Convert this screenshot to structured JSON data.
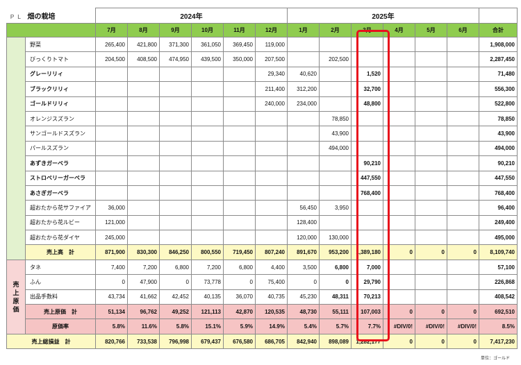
{
  "header": {
    "prefix": "ＰＬ",
    "title": "畑の栽培",
    "year1": "2024年",
    "year2": "2025年"
  },
  "months": [
    "7月",
    "8月",
    "9月",
    "10月",
    "11月",
    "12月",
    "1月",
    "2月",
    "3月",
    "4月",
    "5月",
    "6月"
  ],
  "total_label": "合計",
  "items": [
    {
      "name": "野菜",
      "bold": false,
      "values": [
        "265,400",
        "421,800",
        "371,300",
        "361,050",
        "369,450",
        "119,000",
        "",
        "",
        "",
        "",
        "",
        ""
      ],
      "total": "1,908,000"
    },
    {
      "name": "びっくりトマト",
      "bold": false,
      "values": [
        "204,500",
        "408,500",
        "474,950",
        "439,500",
        "350,000",
        "207,500",
        "",
        "202,500",
        "",
        "",
        "",
        ""
      ],
      "total": "2,287,450"
    },
    {
      "name": "グレーリリィ",
      "bold": true,
      "values": [
        "",
        "",
        "",
        "",
        "",
        "29,340",
        "40,620",
        "",
        "1,520",
        "",
        "",
        ""
      ],
      "total": "71,480"
    },
    {
      "name": "ブラックリリィ",
      "bold": true,
      "values": [
        "",
        "",
        "",
        "",
        "",
        "211,400",
        "312,200",
        "",
        "32,700",
        "",
        "",
        ""
      ],
      "total": "556,300"
    },
    {
      "name": "ゴールドリリィ",
      "bold": true,
      "values": [
        "",
        "",
        "",
        "",
        "",
        "240,000",
        "234,000",
        "",
        "48,800",
        "",
        "",
        ""
      ],
      "total": "522,800"
    },
    {
      "name": "オレンジスズラン",
      "bold": false,
      "values": [
        "",
        "",
        "",
        "",
        "",
        "",
        "",
        "78,850",
        "",
        "",
        "",
        ""
      ],
      "total": "78,850"
    },
    {
      "name": "サンゴールドスズラン",
      "bold": false,
      "values": [
        "",
        "",
        "",
        "",
        "",
        "",
        "",
        "43,900",
        "",
        "",
        "",
        ""
      ],
      "total": "43,900"
    },
    {
      "name": "パールスズラン",
      "bold": false,
      "values": [
        "",
        "",
        "",
        "",
        "",
        "",
        "",
        "494,000",
        "",
        "",
        "",
        ""
      ],
      "total": "494,000"
    },
    {
      "name": "あずきガーベラ",
      "bold": true,
      "values": [
        "",
        "",
        "",
        "",
        "",
        "",
        "",
        "",
        "90,210",
        "",
        "",
        ""
      ],
      "total": "90,210"
    },
    {
      "name": "ストロベリーガーベラ",
      "bold": true,
      "values": [
        "",
        "",
        "",
        "",
        "",
        "",
        "",
        "",
        "447,550",
        "",
        "",
        ""
      ],
      "total": "447,550"
    },
    {
      "name": "あさぎガーベラ",
      "bold": true,
      "values": [
        "",
        "",
        "",
        "",
        "",
        "",
        "",
        "",
        "768,400",
        "",
        "",
        ""
      ],
      "total": "768,400"
    },
    {
      "name": "超おたから花サファイア",
      "bold": false,
      "values": [
        "36,000",
        "",
        "",
        "",
        "",
        "",
        "56,450",
        "3,950",
        "",
        "",
        "",
        ""
      ],
      "total": "96,400"
    },
    {
      "name": "超おたから花ルビー",
      "bold": false,
      "values": [
        "121,000",
        "",
        "",
        "",
        "",
        "",
        "128,400",
        "",
        "",
        "",
        "",
        ""
      ],
      "total": "249,400"
    },
    {
      "name": "超おたから花ダイヤ",
      "bold": false,
      "values": [
        "245,000",
        "",
        "",
        "",
        "",
        "",
        "120,000",
        "130,000",
        "",
        "",
        "",
        ""
      ],
      "total": "495,000"
    }
  ],
  "sales_total": {
    "label": "売上高　計",
    "values": [
      "871,900",
      "830,300",
      "846,250",
      "800,550",
      "719,450",
      "807,240",
      "891,670",
      "953,200",
      "1,389,180",
      "0",
      "0",
      "0"
    ],
    "total": "8,109,740"
  },
  "cost_section_label": [
    "売",
    "上",
    "原",
    "価"
  ],
  "costs": [
    {
      "name": "タネ",
      "values": [
        "7,400",
        "7,200",
        "6,800",
        "7,200",
        "6,800",
        "4,400",
        "3,500",
        "6,800",
        "7,000",
        "",
        "",
        ""
      ],
      "total": "57,100"
    },
    {
      "name": "ふん",
      "values": [
        "0",
        "47,900",
        "0",
        "73,778",
        "0",
        "75,400",
        "0",
        "0",
        "29,790",
        "",
        "",
        ""
      ],
      "total": "226,868"
    },
    {
      "name": "出品手数料",
      "values": [
        "43,734",
        "41,662",
        "42,452",
        "40,135",
        "36,070",
        "40,735",
        "45,230",
        "48,311",
        "70,213",
        "",
        "",
        ""
      ],
      "total": "408,542"
    }
  ],
  "cost_total": {
    "label": "売上原価　計",
    "values": [
      "51,134",
      "96,762",
      "49,252",
      "121,113",
      "42,870",
      "120,535",
      "48,730",
      "55,111",
      "107,003",
      "0",
      "0",
      "0"
    ],
    "total": "692,510"
  },
  "cost_ratio": {
    "label": "原価率",
    "values": [
      "5.8%",
      "11.6%",
      "5.8%",
      "15.1%",
      "5.9%",
      "14.9%",
      "5.4%",
      "5.7%",
      "7.7%",
      "#DIV/0!",
      "#DIV/0!",
      "#DIV/0!"
    ],
    "total": "8.5%"
  },
  "gross_profit": {
    "label": "売上総損益　計",
    "values": [
      "820,766",
      "733,538",
      "796,998",
      "679,437",
      "676,580",
      "686,705",
      "842,940",
      "898,089",
      "1,282,177",
      "0",
      "0",
      "0"
    ],
    "total": "7,417,230"
  },
  "unit_note": "単位：ゴールド",
  "accent": {
    "highlight": "#e8101c",
    "header_green": "#8fcc4f",
    "total_yellow": "#fdf9c4",
    "cost_pink": "#f6c4c4"
  }
}
